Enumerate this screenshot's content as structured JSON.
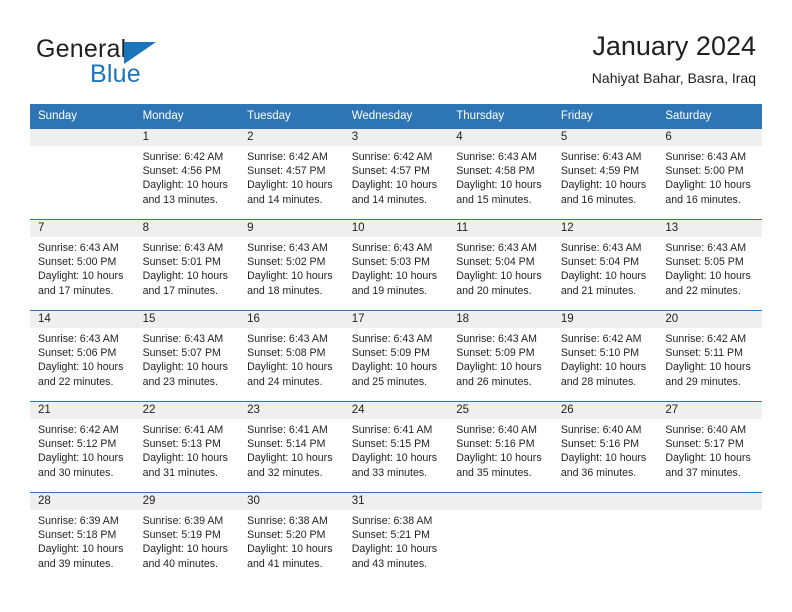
{
  "brand": {
    "name_part1": "General",
    "name_part2": "Blue",
    "triangle_icon": "blue-triangle-icon",
    "color_dark": "#231f20",
    "color_blue": "#1b75bb"
  },
  "header": {
    "title": "January 2024",
    "subtitle": "Nahiyat Bahar, Basra, Iraq"
  },
  "theme": {
    "header_blue": "#2e75b6",
    "daynum_band": "#efefef",
    "text": "#231f20"
  },
  "weekday_headers": [
    "Sunday",
    "Monday",
    "Tuesday",
    "Wednesday",
    "Thursday",
    "Friday",
    "Saturday"
  ],
  "labels": {
    "sunrise_prefix": "Sunrise:",
    "sunset_prefix": "Sunset:",
    "daylight_prefix": "Daylight:"
  },
  "weeks": [
    [
      {
        "day": "",
        "sunrise": "",
        "sunset": "",
        "daylight": ""
      },
      {
        "day": "1",
        "sunrise": "Sunrise: 6:42 AM",
        "sunset": "Sunset: 4:56 PM",
        "daylight": "Daylight: 10 hours and 13 minutes."
      },
      {
        "day": "2",
        "sunrise": "Sunrise: 6:42 AM",
        "sunset": "Sunset: 4:57 PM",
        "daylight": "Daylight: 10 hours and 14 minutes."
      },
      {
        "day": "3",
        "sunrise": "Sunrise: 6:42 AM",
        "sunset": "Sunset: 4:57 PM",
        "daylight": "Daylight: 10 hours and 14 minutes."
      },
      {
        "day": "4",
        "sunrise": "Sunrise: 6:43 AM",
        "sunset": "Sunset: 4:58 PM",
        "daylight": "Daylight: 10 hours and 15 minutes."
      },
      {
        "day": "5",
        "sunrise": "Sunrise: 6:43 AM",
        "sunset": "Sunset: 4:59 PM",
        "daylight": "Daylight: 10 hours and 16 minutes."
      },
      {
        "day": "6",
        "sunrise": "Sunrise: 6:43 AM",
        "sunset": "Sunset: 5:00 PM",
        "daylight": "Daylight: 10 hours and 16 minutes."
      }
    ],
    [
      {
        "day": "7",
        "sunrise": "Sunrise: 6:43 AM",
        "sunset": "Sunset: 5:00 PM",
        "daylight": "Daylight: 10 hours and 17 minutes."
      },
      {
        "day": "8",
        "sunrise": "Sunrise: 6:43 AM",
        "sunset": "Sunset: 5:01 PM",
        "daylight": "Daylight: 10 hours and 17 minutes."
      },
      {
        "day": "9",
        "sunrise": "Sunrise: 6:43 AM",
        "sunset": "Sunset: 5:02 PM",
        "daylight": "Daylight: 10 hours and 18 minutes."
      },
      {
        "day": "10",
        "sunrise": "Sunrise: 6:43 AM",
        "sunset": "Sunset: 5:03 PM",
        "daylight": "Daylight: 10 hours and 19 minutes."
      },
      {
        "day": "11",
        "sunrise": "Sunrise: 6:43 AM",
        "sunset": "Sunset: 5:04 PM",
        "daylight": "Daylight: 10 hours and 20 minutes."
      },
      {
        "day": "12",
        "sunrise": "Sunrise: 6:43 AM",
        "sunset": "Sunset: 5:04 PM",
        "daylight": "Daylight: 10 hours and 21 minutes."
      },
      {
        "day": "13",
        "sunrise": "Sunrise: 6:43 AM",
        "sunset": "Sunset: 5:05 PM",
        "daylight": "Daylight: 10 hours and 22 minutes."
      }
    ],
    [
      {
        "day": "14",
        "sunrise": "Sunrise: 6:43 AM",
        "sunset": "Sunset: 5:06 PM",
        "daylight": "Daylight: 10 hours and 22 minutes."
      },
      {
        "day": "15",
        "sunrise": "Sunrise: 6:43 AM",
        "sunset": "Sunset: 5:07 PM",
        "daylight": "Daylight: 10 hours and 23 minutes."
      },
      {
        "day": "16",
        "sunrise": "Sunrise: 6:43 AM",
        "sunset": "Sunset: 5:08 PM",
        "daylight": "Daylight: 10 hours and 24 minutes."
      },
      {
        "day": "17",
        "sunrise": "Sunrise: 6:43 AM",
        "sunset": "Sunset: 5:09 PM",
        "daylight": "Daylight: 10 hours and 25 minutes."
      },
      {
        "day": "18",
        "sunrise": "Sunrise: 6:43 AM",
        "sunset": "Sunset: 5:09 PM",
        "daylight": "Daylight: 10 hours and 26 minutes."
      },
      {
        "day": "19",
        "sunrise": "Sunrise: 6:42 AM",
        "sunset": "Sunset: 5:10 PM",
        "daylight": "Daylight: 10 hours and 28 minutes."
      },
      {
        "day": "20",
        "sunrise": "Sunrise: 6:42 AM",
        "sunset": "Sunset: 5:11 PM",
        "daylight": "Daylight: 10 hours and 29 minutes."
      }
    ],
    [
      {
        "day": "21",
        "sunrise": "Sunrise: 6:42 AM",
        "sunset": "Sunset: 5:12 PM",
        "daylight": "Daylight: 10 hours and 30 minutes."
      },
      {
        "day": "22",
        "sunrise": "Sunrise: 6:41 AM",
        "sunset": "Sunset: 5:13 PM",
        "daylight": "Daylight: 10 hours and 31 minutes."
      },
      {
        "day": "23",
        "sunrise": "Sunrise: 6:41 AM",
        "sunset": "Sunset: 5:14 PM",
        "daylight": "Daylight: 10 hours and 32 minutes."
      },
      {
        "day": "24",
        "sunrise": "Sunrise: 6:41 AM",
        "sunset": "Sunset: 5:15 PM",
        "daylight": "Daylight: 10 hours and 33 minutes."
      },
      {
        "day": "25",
        "sunrise": "Sunrise: 6:40 AM",
        "sunset": "Sunset: 5:16 PM",
        "daylight": "Daylight: 10 hours and 35 minutes."
      },
      {
        "day": "26",
        "sunrise": "Sunrise: 6:40 AM",
        "sunset": "Sunset: 5:16 PM",
        "daylight": "Daylight: 10 hours and 36 minutes."
      },
      {
        "day": "27",
        "sunrise": "Sunrise: 6:40 AM",
        "sunset": "Sunset: 5:17 PM",
        "daylight": "Daylight: 10 hours and 37 minutes."
      }
    ],
    [
      {
        "day": "28",
        "sunrise": "Sunrise: 6:39 AM",
        "sunset": "Sunset: 5:18 PM",
        "daylight": "Daylight: 10 hours and 39 minutes."
      },
      {
        "day": "29",
        "sunrise": "Sunrise: 6:39 AM",
        "sunset": "Sunset: 5:19 PM",
        "daylight": "Daylight: 10 hours and 40 minutes."
      },
      {
        "day": "30",
        "sunrise": "Sunrise: 6:38 AM",
        "sunset": "Sunset: 5:20 PM",
        "daylight": "Daylight: 10 hours and 41 minutes."
      },
      {
        "day": "31",
        "sunrise": "Sunrise: 6:38 AM",
        "sunset": "Sunset: 5:21 PM",
        "daylight": "Daylight: 10 hours and 43 minutes."
      },
      {
        "day": "",
        "sunrise": "",
        "sunset": "",
        "daylight": ""
      },
      {
        "day": "",
        "sunrise": "",
        "sunset": "",
        "daylight": ""
      },
      {
        "day": "",
        "sunrise": "",
        "sunset": "",
        "daylight": ""
      }
    ]
  ]
}
